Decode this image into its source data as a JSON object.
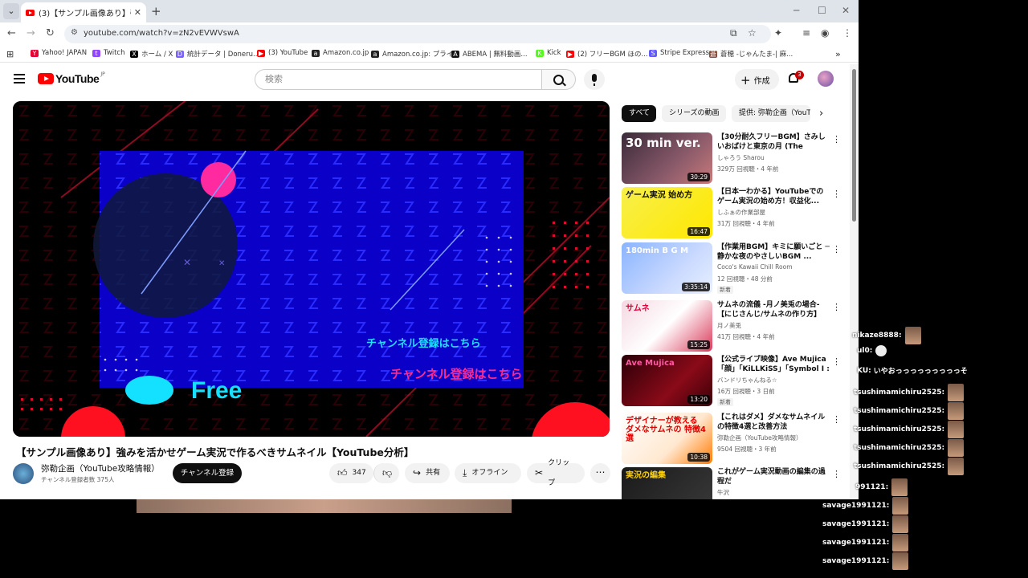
{
  "browser": {
    "tab_title": "(3)【サンプル画像あり】強みを活かせ",
    "url": "youtube.com/watch?v=zN2vEVWVswA",
    "bookmarks": [
      {
        "label": "Yahoo! JAPAN",
        "color": "#e60033",
        "glyph": "Y"
      },
      {
        "label": "Twitch",
        "color": "#9146ff",
        "glyph": "t"
      },
      {
        "label": "ホーム / X",
        "color": "#000000",
        "glyph": "X"
      },
      {
        "label": "統計データ | Doneru...",
        "color": "#7b61ff",
        "glyph": "D"
      },
      {
        "label": "(3) YouTube",
        "color": "#ff0000",
        "glyph": "▶"
      },
      {
        "label": "Amazon.co.jp",
        "color": "#222222",
        "glyph": "a"
      },
      {
        "label": "Amazon.co.jp: プライ...",
        "color": "#222222",
        "glyph": "a"
      },
      {
        "label": "ABEMA | 無料動画...",
        "color": "#111111",
        "glyph": "A"
      },
      {
        "label": "Kick",
        "color": "#53fc18",
        "glyph": "K"
      },
      {
        "label": "(2) フリーBGM ほの...",
        "color": "#ff0000",
        "glyph": "▶"
      },
      {
        "label": "Stripe Express",
        "color": "#635bff",
        "glyph": "S"
      },
      {
        "label": "蒼穂 -じゃんたま-| 麻...",
        "color": "#8a4b3a",
        "glyph": "蒼"
      }
    ]
  },
  "youtube": {
    "logo_text": "YouTube",
    "logo_region": "JP",
    "search_placeholder": "検索",
    "create_label": "作成",
    "notification_count": "3"
  },
  "video": {
    "title": "【サンプル画像あり】強みを活かせゲーム実況で作るべきサムネイル【YouTube分析】",
    "overlay_text_1": "チャンネル登録はこちら",
    "overlay_text_2": "チャンネル登録はこちら",
    "overlay_text_3": "Free",
    "channel_name": "弥勒企画（YouTube攻略情報）",
    "subscribers": "チャンネル登録者数 375人",
    "subscribe_label": "チャンネル登録",
    "like_count": "347",
    "share_label": "共有",
    "offline_label": "オフライン",
    "clip_label": "クリップ"
  },
  "chips": [
    "すべて",
    "シリーズの動画",
    "提供: 弥勒企画（YouT"
  ],
  "recommendations": [
    {
      "title": "【30分耐久フリーBGM】さみしいおばけと東京の月 (The lonel...",
      "channel": "しゃろう Sharou",
      "meta": "329万 回視聴・4 年前",
      "duration": "30:29",
      "badge": "",
      "thumb_text": "30 min ver."
    },
    {
      "title": "【日本一わかる】YouTubeでのゲーム実況の始め方！収益化...",
      "channel": "しふぁの作業部屋",
      "meta": "31万 回視聴・4 年前",
      "duration": "16:47",
      "badge": "",
      "thumb_text": "ゲーム実況 始め方"
    },
    {
      "title": "【作業用BGM】キミに願いごと ─ 静かな夜のやさしいBGM ...",
      "channel": "Coco's Kawaii Chill Room",
      "meta": "12 回視聴・48 分前",
      "duration": "3:35:14",
      "badge": "新着",
      "thumb_text": "180min B G M"
    },
    {
      "title": "サムネの流儀 -月ノ美兎の場合- 【にじさんじ/サムネの作り方】",
      "channel": "月ノ美兎",
      "meta": "41万 回視聴・4 年前",
      "duration": "15:25",
      "badge": "",
      "thumb_text": "サムネ"
    },
    {
      "title": "【公式ライブ映像】Ave Mujica「顔」「KiLLKiSS」「Symbol I : ...",
      "channel": "バンドリちゃんねる☆",
      "meta": "16万 回視聴・3 日前",
      "duration": "13:20",
      "badge": "新着",
      "thumb_text": "Ave Mujica"
    },
    {
      "title": "【これはダメ】ダメなサムネイルの特徴4選と改善方法",
      "channel": "弥勒企画（YouTube攻略情報）",
      "meta": "9504 回視聴・3 年前",
      "duration": "10:38",
      "badge": "",
      "thumb_text": "デザイナーが教える ダメなサムネの 特徴4選"
    },
    {
      "title": "これがゲーム実況動画の編集の過程だ",
      "channel": "牛沢",
      "meta": "",
      "duration": "",
      "badge": "",
      "thumb_text": "実況の編集"
    }
  ],
  "chat": [
    {
      "user": "nikaze8888:",
      "text": "",
      "emote": "face"
    },
    {
      "user": "ul0:",
      "text": "",
      "emote": "white"
    },
    {
      "user": "KU:",
      "text": "いやおっっっっっっっっっそ",
      "emote": ""
    },
    {
      "user": "tsushimamichiru2525:",
      "text": "",
      "emote": "face"
    },
    {
      "user": "tsushimamichiru2525:",
      "text": "",
      "emote": "face"
    },
    {
      "user": "tsushimamichiru2525:",
      "text": "",
      "emote": "face"
    },
    {
      "user": "tsushimamichiru2525:",
      "text": "",
      "emote": "face"
    },
    {
      "user": "tsushimamichiru2525:",
      "text": "",
      "emote": "face"
    },
    {
      "user": "991121:",
      "text": "",
      "emote": "face"
    },
    {
      "user": "savage1991121:",
      "text": "",
      "emote": "face"
    },
    {
      "user": "savage1991121:",
      "text": "",
      "emote": "face"
    },
    {
      "user": "savage1991121:",
      "text": "",
      "emote": "face"
    },
    {
      "user": "savage1991121:",
      "text": "",
      "emote": "face"
    }
  ]
}
